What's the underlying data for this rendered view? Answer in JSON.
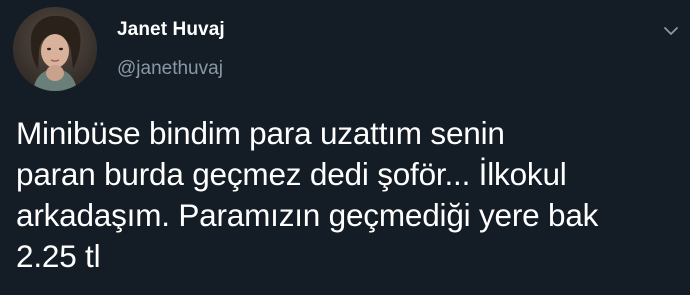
{
  "tweet": {
    "author_name": "Janet Huvaj",
    "author_handle": "@janethuvaj",
    "text": "Minibüse bindim para uzattım senin\nparan burda geçmez dedi şoför... İlkokul\narkadaşım. Paramızın geçmediği yere bak\n2.25 tl",
    "icons": {
      "avatar": "profile-photo",
      "menu": "chevron-down-icon"
    }
  },
  "colors": {
    "background": "#141d26",
    "primary_text": "#ffffff",
    "secondary_text": "#8899a6",
    "icon": "#8899a6"
  }
}
